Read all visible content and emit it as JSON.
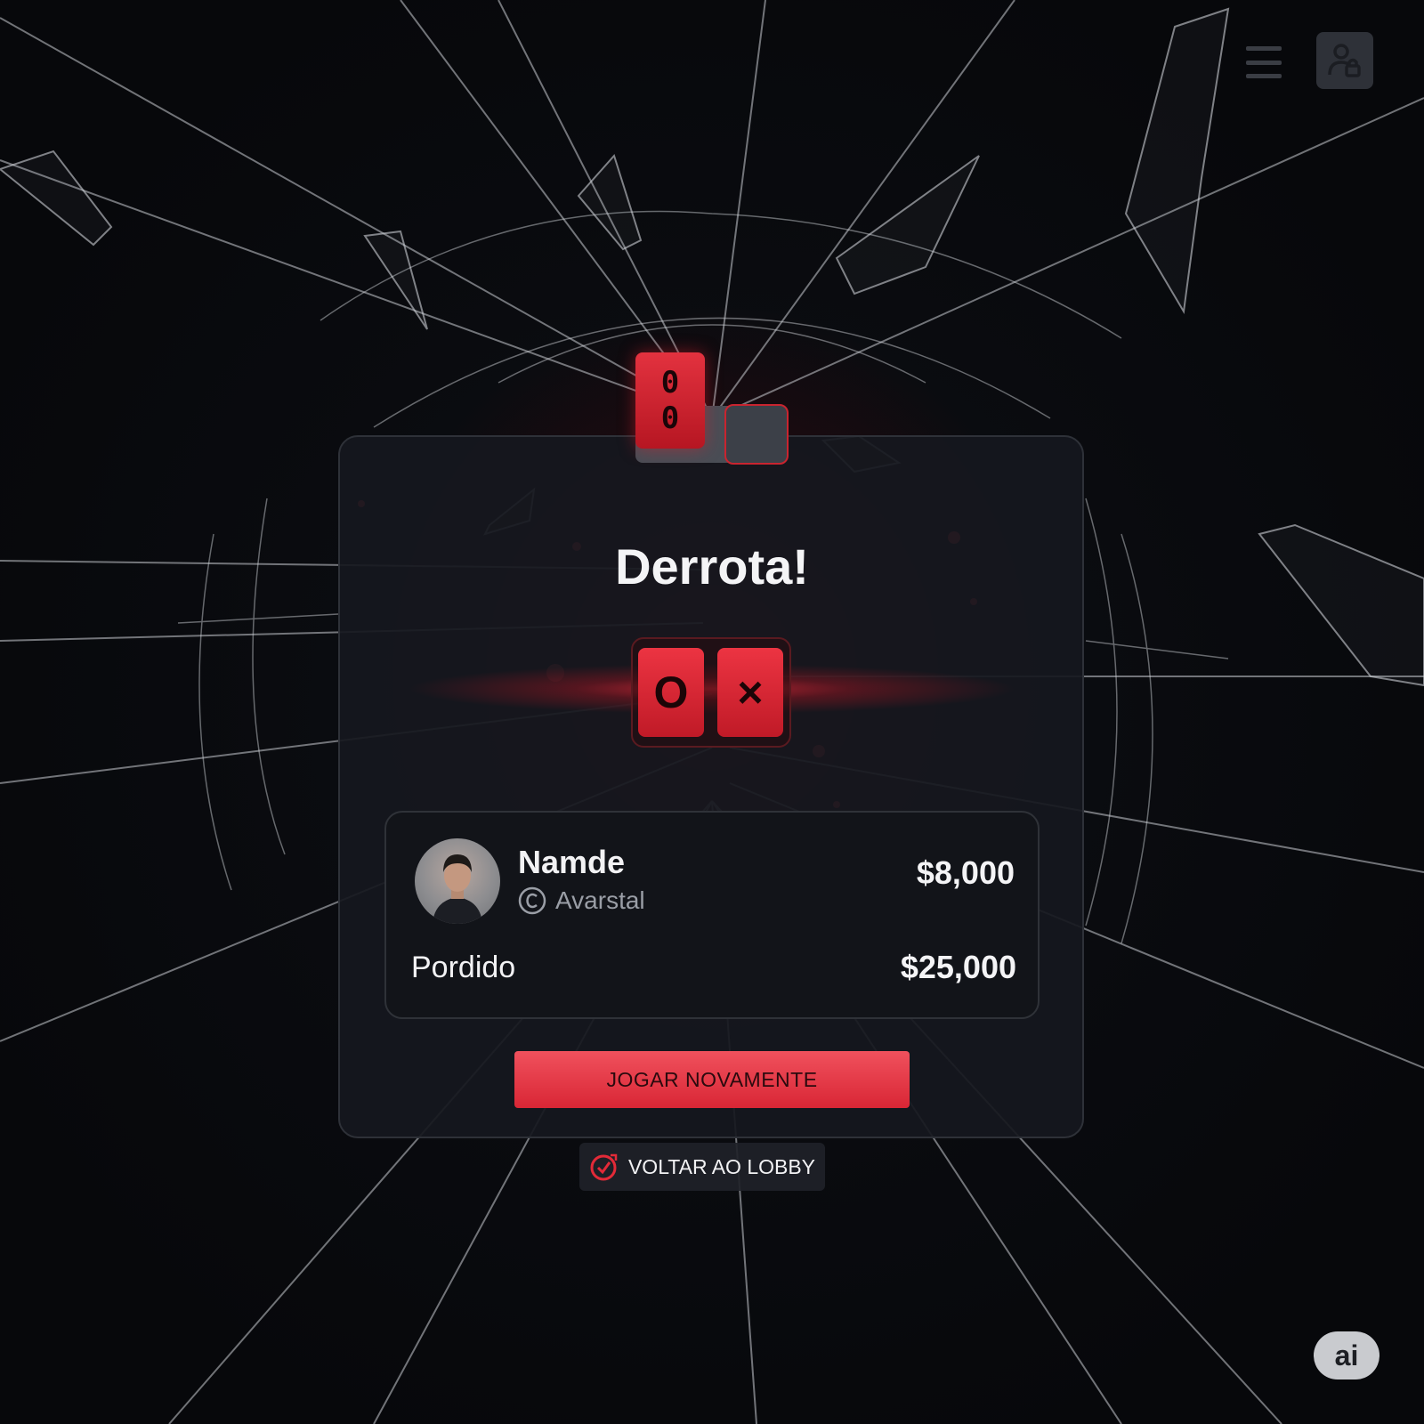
{
  "header": {
    "menu_icon": "hamburger-menu-icon",
    "account_icon": "user-lock-icon"
  },
  "badge": {
    "digits": [
      "0",
      "0"
    ]
  },
  "result": {
    "title": "Derrota!",
    "tiles": [
      "O",
      "×"
    ]
  },
  "player": {
    "name": "Namde",
    "tag": "Avarstal",
    "tag_icon": "coin-icon",
    "amount": "$8,000"
  },
  "loss": {
    "label": "Pordido",
    "amount": "$25,000"
  },
  "actions": {
    "play_again": "JOGAR NOVAMENTE",
    "lobby": "VOLTAR AO LOBBY",
    "lobby_icon": "check-circle-icon"
  },
  "corner_badge": {
    "label": "ai"
  },
  "colors": {
    "accent_red": "#e32a38",
    "card_bg": "#16181e",
    "text_primary": "#f2f2f4",
    "text_muted": "#9a9ea6"
  }
}
